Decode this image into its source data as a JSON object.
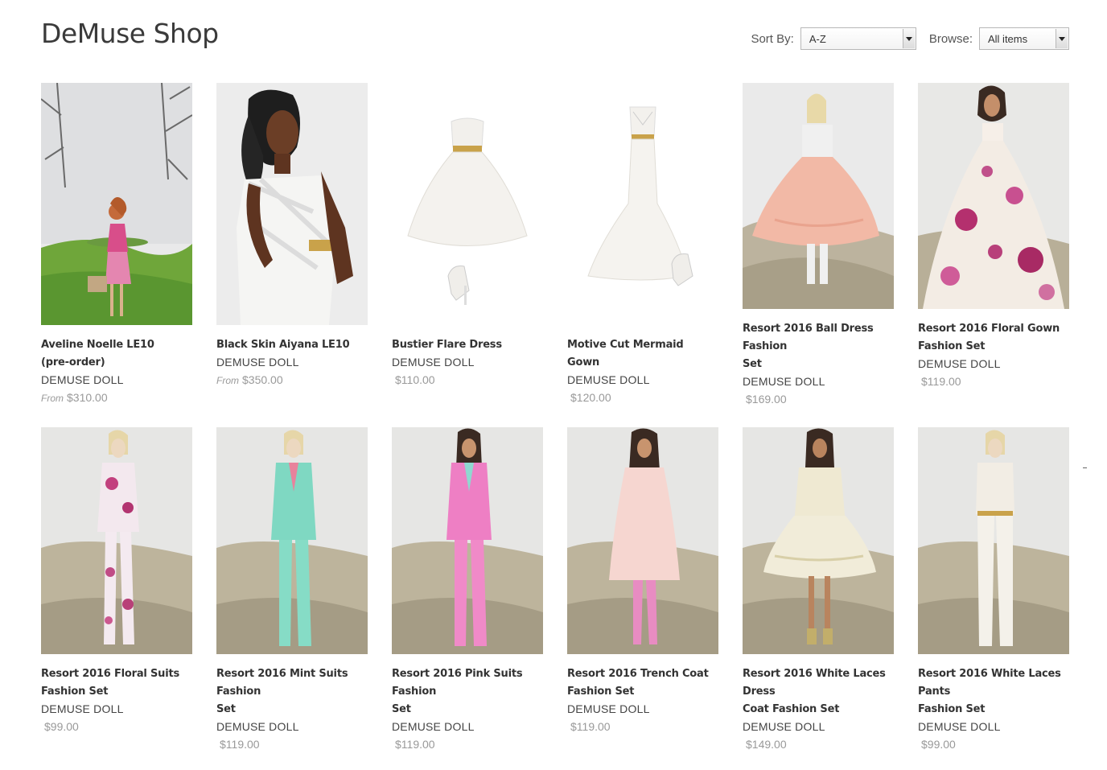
{
  "shop": {
    "title": "DeMuse Shop"
  },
  "controls": {
    "sort_label": "Sort By:",
    "sort_value": "A-Z",
    "browse_label": "Browse:",
    "browse_value": "All items"
  },
  "colors": {
    "price": "#999999",
    "title": "#333333",
    "vendor": "#444444"
  },
  "products": [
    {
      "title_lines": [
        "Aveline Noelle LE10",
        "(pre-order)"
      ],
      "vendor": "DEMUSE DOLL",
      "from": "From",
      "price": "$310.00"
    },
    {
      "title_lines": [
        "Black Skin Aiyana LE10"
      ],
      "vendor": "DEMUSE DOLL",
      "from": "From",
      "price": "$350.00"
    },
    {
      "title_lines": [
        "Bustier Flare Dress"
      ],
      "vendor": "DEMUSE DOLL",
      "from": "",
      "price": "$110.00"
    },
    {
      "title_lines": [
        "Motive Cut Mermaid Gown"
      ],
      "vendor": "DEMUSE DOLL",
      "from": "",
      "price": "$120.00"
    },
    {
      "title_lines": [
        "Resort 2016 Ball Dress Fashion",
        "Set"
      ],
      "vendor": "DEMUSE DOLL",
      "from": "",
      "price": "$169.00"
    },
    {
      "title_lines": [
        "Resort 2016 Floral Gown",
        "Fashion Set"
      ],
      "vendor": "DEMUSE DOLL",
      "from": "",
      "price": "$119.00"
    },
    {
      "title_lines": [
        "Resort 2016 Floral Suits",
        "Fashion Set"
      ],
      "vendor": "DEMUSE DOLL",
      "from": "",
      "price": "$99.00"
    },
    {
      "title_lines": [
        "Resort 2016 Mint Suits Fashion",
        "Set"
      ],
      "vendor": "DEMUSE DOLL",
      "from": "",
      "price": "$119.00"
    },
    {
      "title_lines": [
        "Resort 2016 Pink Suits Fashion",
        "Set"
      ],
      "vendor": "DEMUSE DOLL",
      "from": "",
      "price": "$119.00"
    },
    {
      "title_lines": [
        "Resort 2016 Trench Coat",
        "Fashion Set"
      ],
      "vendor": "DEMUSE DOLL",
      "from": "",
      "price": "$119.00"
    },
    {
      "title_lines": [
        "Resort 2016 White Laces Dress",
        "Coat Fashion Set"
      ],
      "vendor": "DEMUSE DOLL",
      "from": "",
      "price": "$149.00"
    },
    {
      "title_lines": [
        "Resort 2016 White Laces Pants",
        "Fashion Set"
      ],
      "vendor": "DEMUSE DOLL",
      "from": "",
      "price": "$99.00"
    }
  ]
}
